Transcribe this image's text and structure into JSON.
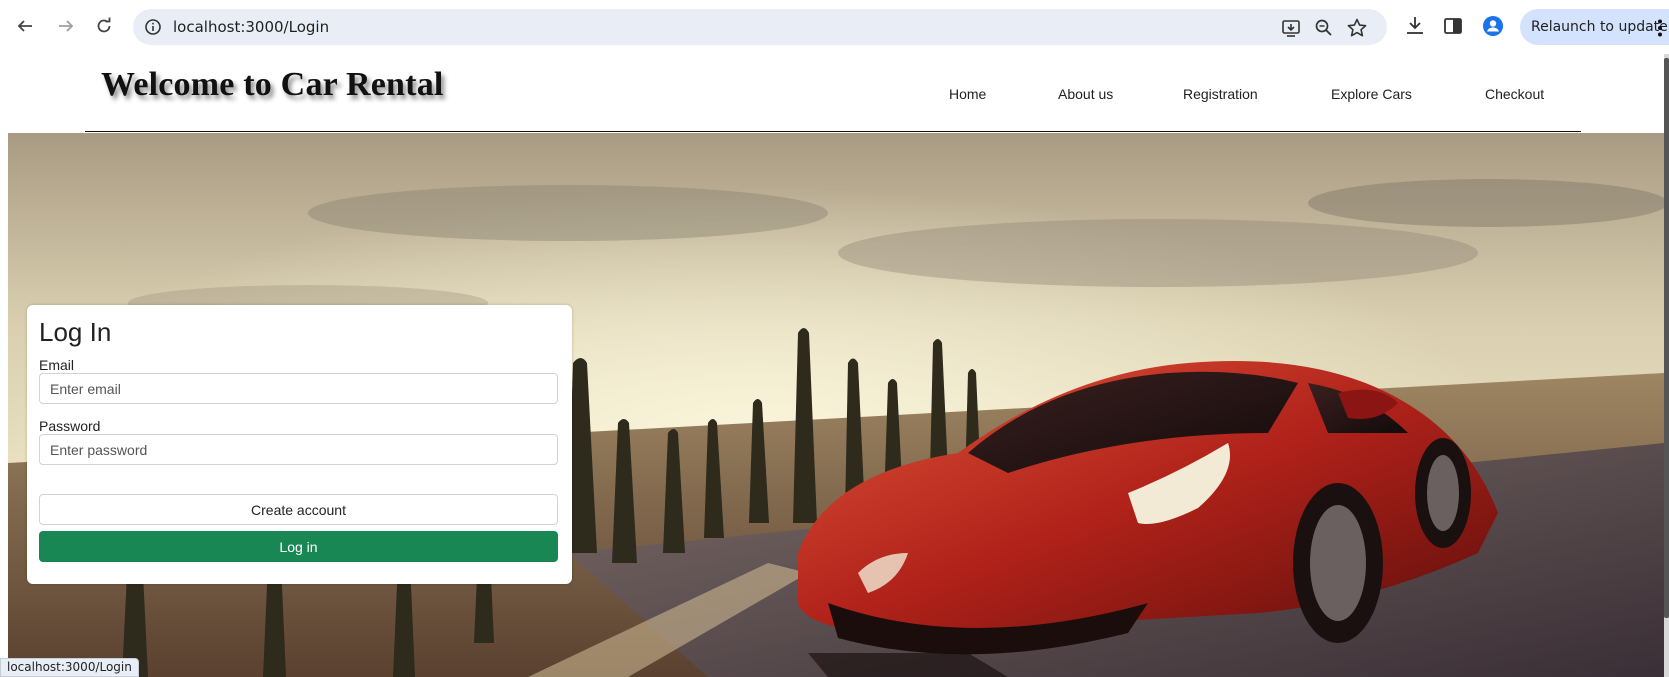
{
  "browser": {
    "url": "localhost:3000/Login",
    "relaunch_label": "Relaunch to update",
    "status_url": "localhost:3000/Login"
  },
  "site": {
    "brand": "Welcome to Car Rental",
    "nav": [
      "Home",
      "About us",
      "Registration",
      "Explore Cars",
      "Checkout"
    ]
  },
  "login": {
    "title": "Log In",
    "email_label": "Email",
    "email_placeholder": "Enter email",
    "password_label": "Password",
    "password_placeholder": "Enter password",
    "create_account_label": "Create account",
    "login_label": "Log in"
  },
  "icons": {
    "back": "back-arrow-icon",
    "forward": "forward-arrow-icon",
    "reload": "reload-icon",
    "site_info": "info-icon",
    "install": "install-app-icon",
    "zoom": "zoom-icon",
    "bookmark": "star-icon",
    "download": "download-icon",
    "side_panel": "side-panel-icon",
    "profile": "profile-icon",
    "menu": "kebab-menu-icon"
  },
  "colors": {
    "primary_button": "#198754",
    "car": "#b0221a",
    "omnibox": "#e9eef6",
    "relaunch_chip": "#d3e3fd"
  }
}
